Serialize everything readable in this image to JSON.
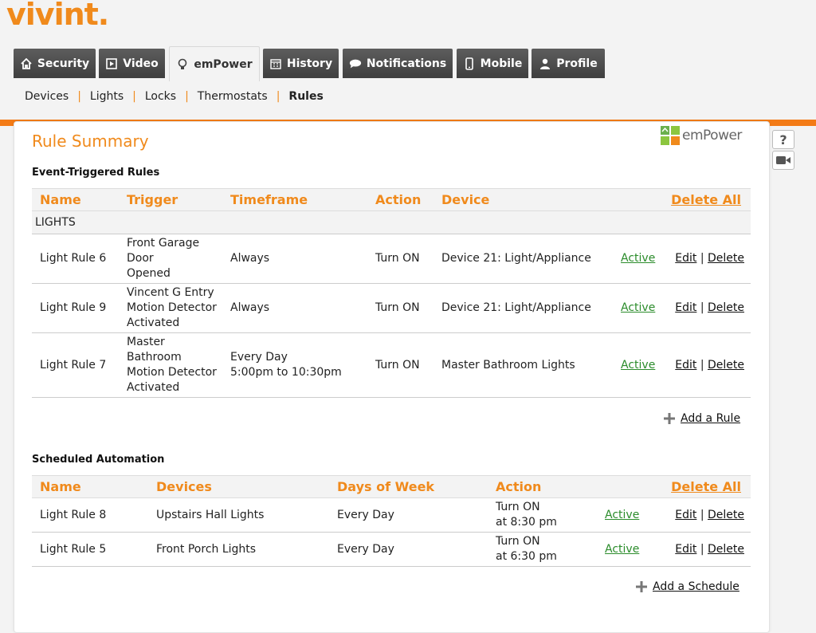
{
  "brand": {
    "logo": "vivint."
  },
  "tabs": [
    {
      "label": "Security",
      "icon": "home-icon"
    },
    {
      "label": "Video",
      "icon": "play-icon"
    },
    {
      "label": "emPower",
      "icon": "lightbulb-icon"
    },
    {
      "label": "History",
      "icon": "calendar-icon"
    },
    {
      "label": "Notifications",
      "icon": "chat-icon"
    },
    {
      "label": "Mobile",
      "icon": "phone-icon"
    },
    {
      "label": "Profile",
      "icon": "person-icon"
    }
  ],
  "active_tab": "emPower",
  "subnav": [
    "Devices",
    "Lights",
    "Locks",
    "Thermostats",
    "Rules"
  ],
  "active_subnav": "Rules",
  "panel": {
    "title": "Rule Summary",
    "empower_logo": "emPower",
    "event_rules": {
      "heading": "Event-Triggered Rules",
      "columns": [
        "Name",
        "Trigger",
        "Timeframe",
        "Action",
        "Device"
      ],
      "delete_all": "Delete All",
      "group": "LIGHTS",
      "rows": [
        {
          "name": "Light Rule 6",
          "trigger": [
            "Front Garage",
            "Door",
            "Opened"
          ],
          "timeframe": [
            "Always"
          ],
          "action": "Turn ON",
          "device": "Device 21: Light/Appliance",
          "status": "Active"
        },
        {
          "name": "Light Rule 9",
          "trigger": [
            "Vincent G Entry",
            "Motion Detector",
            "Activated"
          ],
          "timeframe": [
            "Always"
          ],
          "action": "Turn ON",
          "device": "Device 21: Light/Appliance",
          "status": "Active"
        },
        {
          "name": "Light Rule 7",
          "trigger": [
            "Master",
            "Bathroom",
            "Motion Detector",
            "Activated"
          ],
          "timeframe": [
            "Every Day",
            "5:00pm to 10:30pm"
          ],
          "action": "Turn ON",
          "device": "Master Bathroom Lights",
          "status": "Active"
        }
      ],
      "edit_label": "Edit",
      "delete_label": "Delete",
      "separator": "|",
      "add_label": "Add a Rule"
    },
    "scheduled": {
      "heading": "Scheduled Automation",
      "columns": [
        "Name",
        "Devices",
        "Days of Week",
        "Action"
      ],
      "delete_all": "Delete All",
      "rows": [
        {
          "name": "Light Rule 8",
          "devices": "Upstairs Hall Lights",
          "days": "Every Day",
          "action": [
            "Turn ON",
            "at 8:30 pm"
          ],
          "status": "Active"
        },
        {
          "name": "Light Rule 5",
          "devices": "Front Porch Lights",
          "days": "Every Day",
          "action": [
            "Turn ON",
            "at 6:30 pm"
          ],
          "status": "Active"
        }
      ],
      "edit_label": "Edit",
      "delete_label": "Delete",
      "separator": "|",
      "add_label": "Add a Schedule"
    }
  },
  "side": {
    "help_label": "?",
    "video_icon": "video-camera-icon"
  },
  "colors": {
    "accent": "#f08a1c",
    "tabbar": "#f37b16",
    "active_green": "#2b8c2b"
  }
}
